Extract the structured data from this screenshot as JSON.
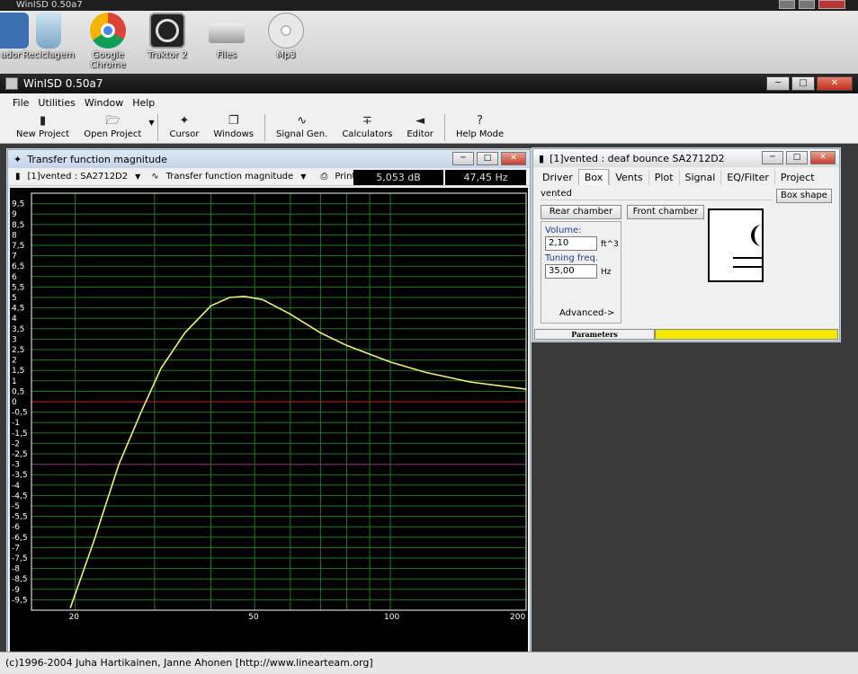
{
  "background_window": {
    "title": "WinISD 0.50a7"
  },
  "desktop_icons": [
    {
      "label": "ador",
      "icon": "computer-icon"
    },
    {
      "label": "Reciclagem",
      "icon": "recycle-bin-icon"
    },
    {
      "label": "Google Chrome",
      "icon": "chrome-icon"
    },
    {
      "label": "Traktor 2",
      "icon": "traktor-icon"
    },
    {
      "label": "Files",
      "icon": "drive-icon"
    },
    {
      "label": "Mp3",
      "icon": "cd-icon"
    }
  ],
  "main_window": {
    "title": "WinISD 0.50a7"
  },
  "menu": [
    "File",
    "Utilities",
    "Window",
    "Help"
  ],
  "toolbar": [
    {
      "label": "New Project",
      "icon": "new-project-icon"
    },
    {
      "label": "Open Project",
      "icon": "open-folder-icon"
    },
    {
      "label": "Cursor",
      "icon": "cursor-icon"
    },
    {
      "label": "Windows",
      "icon": "windows-icon"
    },
    {
      "label": "Signal Gen.",
      "icon": "sine-wave-icon"
    },
    {
      "label": "Calculators",
      "icon": "calculator-icon"
    },
    {
      "label": "Editor",
      "icon": "speaker-icon"
    },
    {
      "label": "Help Mode",
      "icon": "help-icon"
    }
  ],
  "tf_window": {
    "title": "Transfer function magnitude",
    "project_select": "[1]vented : SA2712D2",
    "graph_select": "Transfer function magnitude",
    "print_label": "Print",
    "readout_db": "5,053 dB",
    "readout_hz": "47,45 Hz"
  },
  "chart_data": {
    "type": "line",
    "xscale": "log",
    "xlim": [
      16,
      200
    ],
    "ylim": [
      -10,
      10
    ],
    "x_ticks": [
      "20",
      "50",
      "100",
      "200"
    ],
    "y_ticks": [
      "9,5",
      "9",
      "8,5",
      "8",
      "7,5",
      "7",
      "6,5",
      "6",
      "5,5",
      "5",
      "4,5",
      "4",
      "3,5",
      "3",
      "2,5",
      "2",
      "1,5",
      "1",
      "0,5",
      "0",
      "-0,5",
      "-1",
      "-1,5",
      "-2",
      "-2,5",
      "-3",
      "-3,5",
      "-4",
      "-4,5",
      "-5",
      "-5,5",
      "-6",
      "-6,5",
      "-7",
      "-7,5",
      "-8",
      "-8,5",
      "-9",
      "-9,5"
    ],
    "reference_lines": [
      {
        "y": 0,
        "color": "#cc2222"
      },
      {
        "y": -3,
        "color": "#882288"
      }
    ],
    "series": [
      {
        "color": "#f0f070",
        "x": [
          19.5,
          22,
          25,
          28,
          31,
          35,
          40,
          44,
          47.45,
          52,
          60,
          70,
          80,
          100,
          120,
          150,
          200
        ],
        "y": [
          -9.9,
          -6.7,
          -3.0,
          -0.5,
          1.6,
          3.3,
          4.6,
          5.0,
          5.05,
          4.9,
          4.2,
          3.3,
          2.7,
          1.9,
          1.4,
          0.95,
          0.6
        ]
      }
    ]
  },
  "box_window": {
    "title": "[1]vented : deaf bounce SA2712D2",
    "tabs": [
      "Driver",
      "Box",
      "Vents",
      "Plot",
      "Signal",
      "EQ/Filter",
      "Project"
    ],
    "box_type": "vented",
    "box_shape_button": "Box shape",
    "rear_chamber": "Rear chamber",
    "front_chamber": "Front chamber",
    "volume_label": "Volume:",
    "volume_value": "2,10",
    "volume_unit": "ft^3",
    "tuning_label": "Tuning freq.",
    "tuning_value": "35,00",
    "tuning_unit": "Hz",
    "advanced": "Advanced->",
    "status_label": "Parameters"
  },
  "status_bar": "(c)1996-2004 Juha Hartikainen, Janne Ahonen [http://www.linearteam.org]"
}
